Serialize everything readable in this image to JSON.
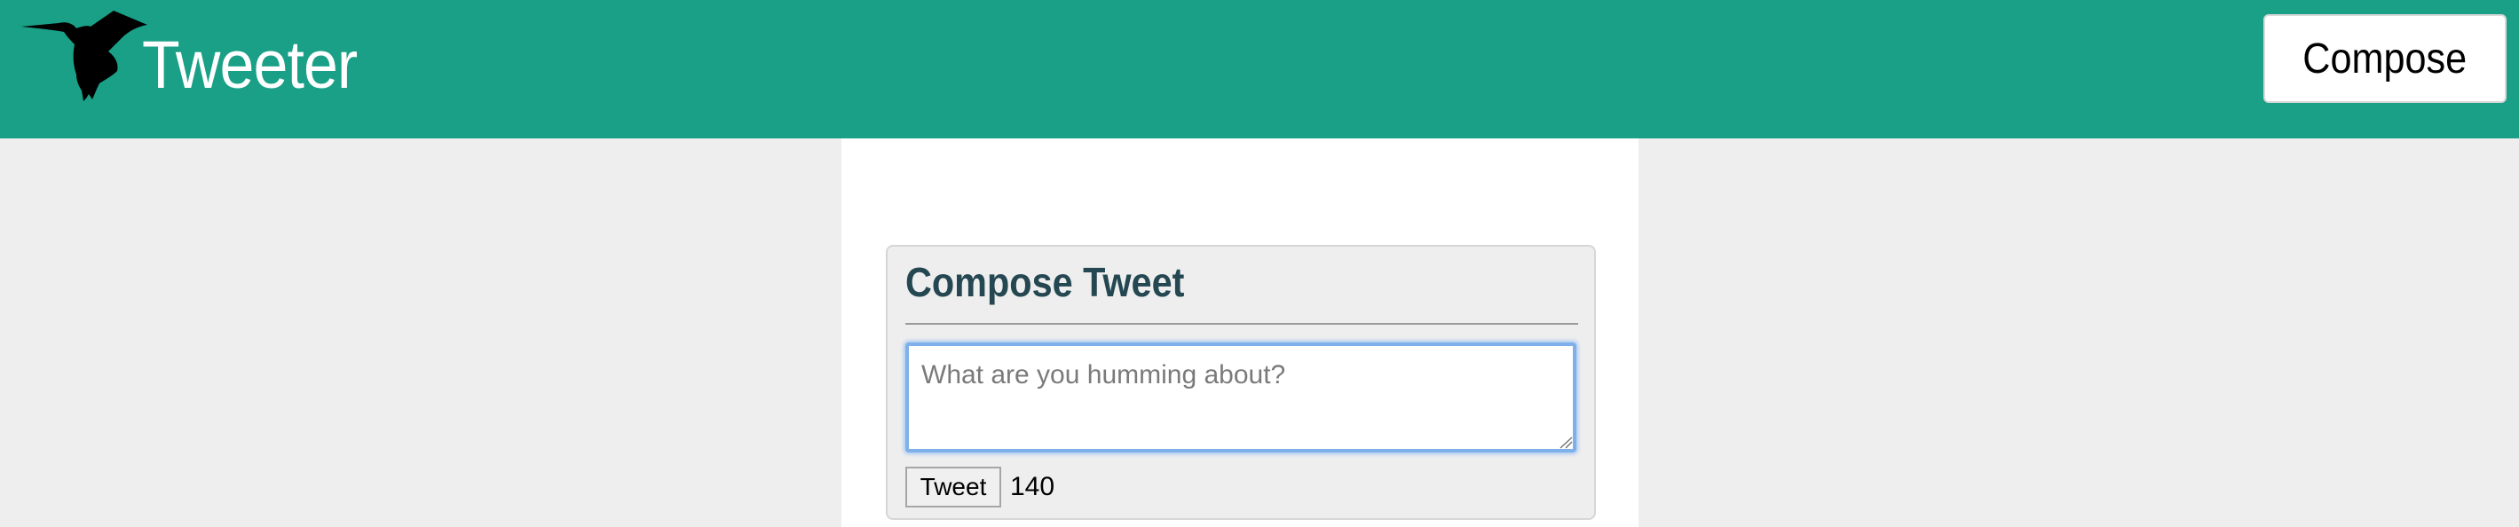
{
  "header": {
    "brand": "Tweeter",
    "logo_icon": "hummingbird-icon",
    "compose_button_label": "Compose"
  },
  "composer": {
    "title": "Compose Tweet",
    "textarea_value": "",
    "textarea_placeholder": "What are you humming about?",
    "tweet_button_label": "Tweet",
    "char_counter": "140"
  },
  "colors": {
    "navbar": "#19a087",
    "page_background": "#eeeeee",
    "title": "#244751"
  }
}
